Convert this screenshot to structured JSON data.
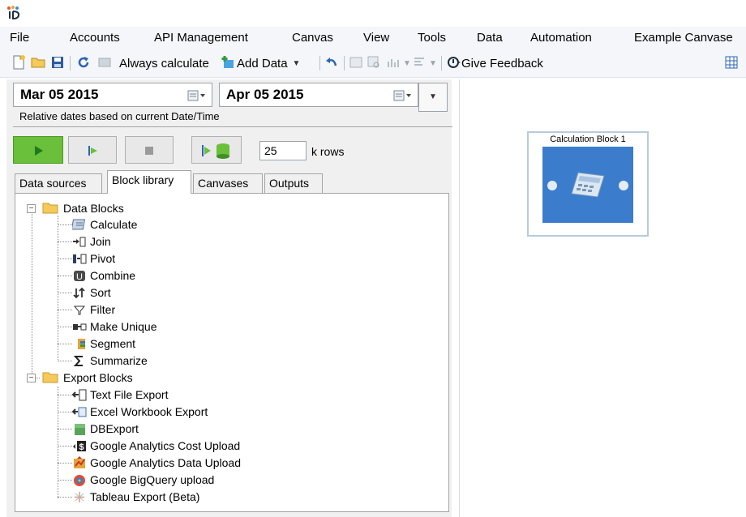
{
  "menu": [
    "File",
    "Accounts",
    "API Management",
    "Canvas",
    "View",
    "Tools",
    "Data",
    "Automation",
    "Example Canvase"
  ],
  "toolbar": {
    "calc_mode": "Always calculate",
    "add_data": "Add Data",
    "give_feedback": "Give Feedback"
  },
  "dates": {
    "start": "Mar 05 2015",
    "end": "Apr 05 2015",
    "relative_label": "Relative dates based on current Date/Time"
  },
  "rows": {
    "value": "25",
    "unit": "k rows"
  },
  "tabs": [
    "Data sources",
    "Block library",
    "Canvases",
    "Outputs"
  ],
  "tree": {
    "data_blocks": {
      "label": "Data Blocks",
      "items": [
        "Calculate",
        "Join",
        "Pivot",
        "Combine",
        "Sort",
        "Filter",
        "Make Unique",
        "Segment",
        "Summarize"
      ]
    },
    "export_blocks": {
      "label": "Export Blocks",
      "items": [
        "Text File Export",
        "Excel Workbook Export",
        "DBExport",
        "Google Analytics Cost Upload",
        "Google Analytics Data Upload",
        "Google BigQuery upload",
        "Tableau Export (Beta)"
      ]
    }
  },
  "canvas": {
    "block_title": "Calculation Block 1"
  },
  "colors": {
    "block_blue": "#3b7dcc",
    "run_green": "#6abf3b"
  }
}
